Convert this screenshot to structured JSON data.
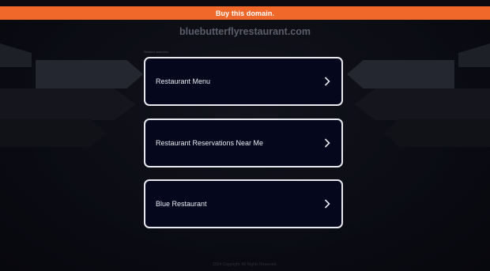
{
  "banner": {
    "buy_label": "Buy this domain.",
    "color": "#f0682a"
  },
  "domain": {
    "name": "bluebutterflyrestaurant.com"
  },
  "related": {
    "heading": "Related searches",
    "links": [
      {
        "label": "Restaurant Menu",
        "icon": "chevron-right-icon"
      },
      {
        "label": "Restaurant Reservations Near Me",
        "icon": "chevron-right-icon"
      },
      {
        "label": "Blue Restaurant",
        "icon": "chevron-right-icon"
      }
    ]
  },
  "footer": {
    "text": "2024 Copyright. All Rights Reserved."
  }
}
